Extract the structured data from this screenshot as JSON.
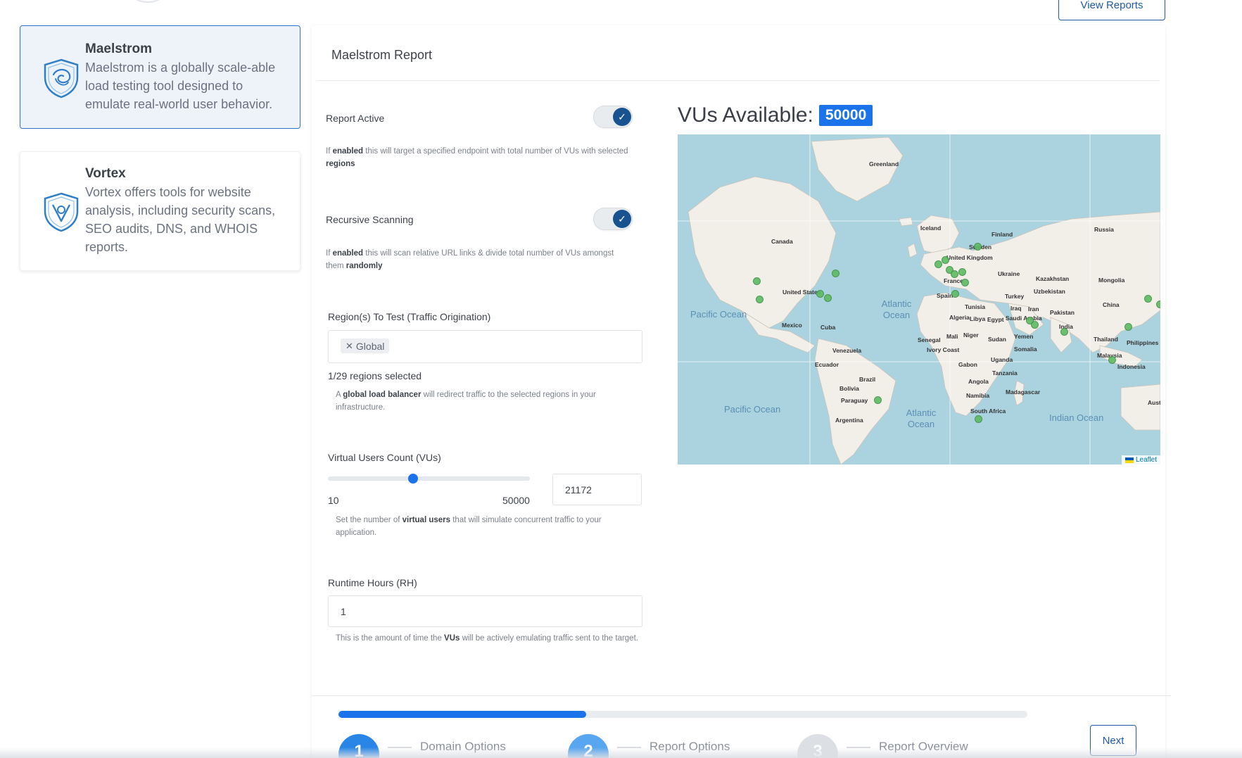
{
  "header": {
    "view_reports_label": "View Reports"
  },
  "tools": [
    {
      "title": "Maelstrom",
      "description": "Maelstrom is a globally scale-able load testing tool designed to emulate real-world user behavior.",
      "active": true,
      "icon": "swirl-shield-icon"
    },
    {
      "title": "Vortex",
      "description": "Vortex offers tools for website analysis, including security scans, SEO audits, DNS, and WHOIS reports.",
      "active": false,
      "icon": "vortex-shield-icon"
    }
  ],
  "report": {
    "title": "Maelstrom Report",
    "report_active": {
      "label": "Report Active",
      "enabled": true,
      "help_pre": "If ",
      "help_b1": "enabled",
      "help_mid": " this will target a specified endpoint with total number of VUs with selected ",
      "help_b2": "regions"
    },
    "recursive_scanning": {
      "label": "Recursive Scanning",
      "enabled": true,
      "help_pre": "If ",
      "help_b1": "enabled",
      "help_mid": " this will scan relative URL links & divide total number of VUs amongst them ",
      "help_b2": "randomly"
    },
    "regions": {
      "label": "Region(s) To Test (Traffic Origination)",
      "selected_tags": [
        "Global"
      ],
      "count_text": "1/29 regions selected",
      "help_pre": "A ",
      "help_b1": "global load balancer",
      "help_post": " will redirect traffic to the selected regions in your infrastructure."
    },
    "virtual_users": {
      "label": "Virtual Users Count (VUs)",
      "min": 10,
      "max": 50000,
      "value": 21172,
      "min_label": "10",
      "max_label": "50000",
      "value_text": "21172",
      "help_pre": "Set the number of ",
      "help_b1": "virtual users",
      "help_post": " that will simulate concurrent traffic to your application."
    },
    "runtime": {
      "label": "Runtime Hours (RH)",
      "value": "1",
      "help_pre": "This is the amount of time the ",
      "help_b1": "VUs",
      "help_post": " will be actively emulating traffic sent to the target."
    }
  },
  "map": {
    "heading": "VUs Available:",
    "available": "50000",
    "attribution": "Leaflet",
    "labels": [
      "Greenland",
      "Iceland",
      "Finland",
      "Russia",
      "Sweden",
      "Canada",
      "United Kingdom",
      "Ukraine",
      "Kazakhstan",
      "Mongolia",
      "France",
      "Uzbekistan",
      "United States",
      "Spain",
      "Turkey",
      "China",
      "Tunisia",
      "Iraq",
      "Iran",
      "Pakistan",
      "Mexico",
      "Cuba",
      "Algeria",
      "Libya",
      "Egypt",
      "Saudi Arabia",
      "India",
      "Mali",
      "Niger",
      "Yemen",
      "Thailand",
      "Philippines",
      "Senegal",
      "Sudan",
      "Ivory Coast",
      "Somalia",
      "Venezuela",
      "Gabon",
      "Uganda",
      "Malaysia",
      "Ecuador",
      "Indonesia",
      "Tanzania",
      "Brazil",
      "Angola",
      "Bolivia",
      "Madagascar",
      "Namibia",
      "Paraguay",
      "South Africa",
      "Argentina",
      "Aust"
    ],
    "oceans": [
      "Pacific Ocean",
      "Atlantic Ocean",
      "Pacific Ocean",
      "Atlantic Ocean",
      "Indian Ocean"
    ],
    "markers": [
      "us-west-1",
      "us-west-2",
      "us-east-1",
      "us-east-2",
      "ca-central-1",
      "eu-west-1",
      "eu-west-2",
      "eu-west-3",
      "eu-central-1",
      "eu-north-1",
      "eu-south-1",
      "me-south-1",
      "me-central-1",
      "ap-south-1",
      "ap-northeast-1",
      "ap-southeast-1",
      "ap-east-1",
      "af-south-1",
      "sa-east-1",
      "eu-south-2",
      "ap-northeast-2",
      "il-central-1"
    ]
  },
  "wizard": {
    "progress": 0.36,
    "steps": [
      {
        "number": "1",
        "label": "Domain Options",
        "state": "done"
      },
      {
        "number": "2",
        "label": "Report Options",
        "state": "current"
      },
      {
        "number": "3",
        "label": "Report Overview",
        "state": "pending"
      }
    ],
    "next_label": "Next"
  },
  "colors": {
    "accent": "#1a73e8",
    "dark_accent": "#18528f",
    "outline": "#1f5aa8",
    "marker": "#5dbb63"
  }
}
